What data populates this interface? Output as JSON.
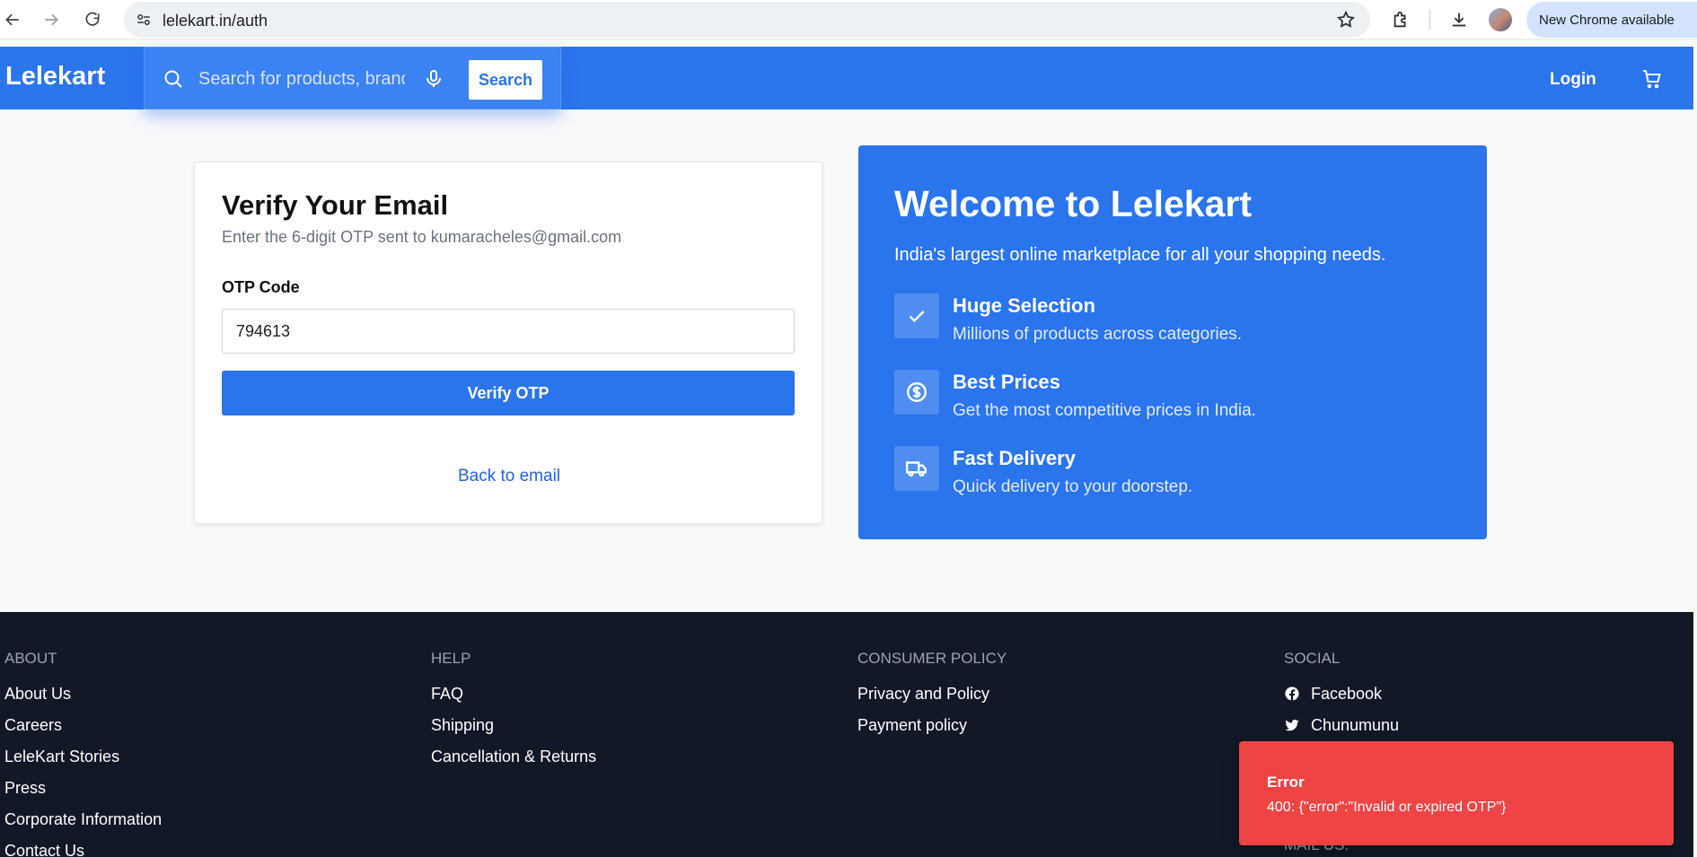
{
  "browser": {
    "url": "lelekart.in/auth",
    "update_label": "New Chrome available"
  },
  "header": {
    "logo": "Lelekart",
    "search_placeholder": "Search for products, brands",
    "search_button": "Search",
    "login": "Login"
  },
  "auth": {
    "title": "Verify Your Email",
    "subtitle": "Enter the 6-digit OTP sent to kumaracheles@gmail.com",
    "otp_label": "OTP Code",
    "otp_value": "794613",
    "verify_button": "Verify OTP",
    "back_link": "Back to email"
  },
  "welcome": {
    "title": "Welcome to Lelekart",
    "subtitle": "India's largest online marketplace for all your shopping needs.",
    "features": [
      {
        "icon": "check-icon",
        "title": "Huge Selection",
        "desc": "Millions of products across categories."
      },
      {
        "icon": "dollar-icon",
        "title": "Best Prices",
        "desc": "Get the most competitive prices in India."
      },
      {
        "icon": "truck-icon",
        "title": "Fast Delivery",
        "desc": "Quick delivery to your doorstep."
      }
    ]
  },
  "footer": {
    "about": {
      "title": "ABOUT",
      "links": [
        "About Us",
        "Careers",
        "LeleKart Stories",
        "Press",
        "Corporate Information",
        "Contact Us"
      ]
    },
    "help": {
      "title": "HELP",
      "links": [
        "FAQ",
        "Shipping",
        "Cancellation & Returns"
      ]
    },
    "policy": {
      "title": "CONSUMER POLICY",
      "links": [
        "Privacy and Policy",
        "Payment policy"
      ]
    },
    "social": {
      "title": "SOCIAL",
      "links": [
        "Facebook",
        "Chunumunu"
      ]
    },
    "mail_title": "MAIL US:"
  },
  "toast": {
    "title": "Error",
    "message": "400: {\"error\":\"Invalid or expired OTP\"}"
  },
  "colors": {
    "brand": "#2a74ec",
    "footer_bg": "#121826",
    "error": "#ef4444"
  }
}
